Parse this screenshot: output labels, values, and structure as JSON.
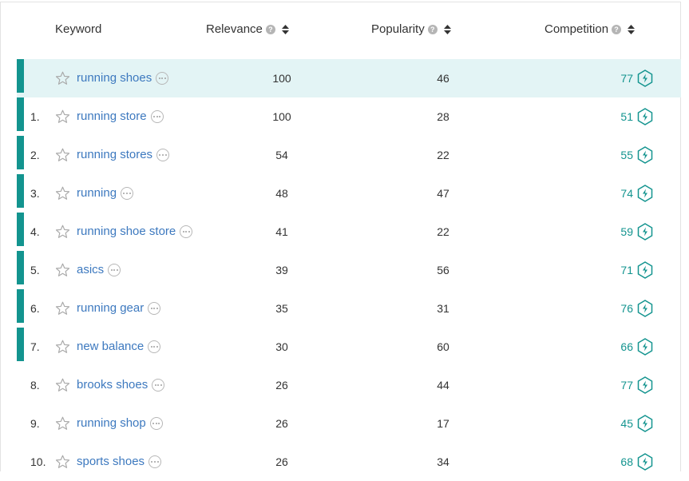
{
  "header": {
    "keyword": "Keyword",
    "relevance": "Relevance",
    "popularity": "Popularity",
    "competition": "Competition",
    "help_glyph": "?"
  },
  "colors": {
    "accent": "#13948f",
    "highlight_row": "#e3f4f5",
    "link": "#3d79bf"
  },
  "rows": [
    {
      "num": "",
      "keyword": "running shoes",
      "relevance": "100",
      "popularity": "46",
      "competition": "77",
      "highlighted": true,
      "bar": true
    },
    {
      "num": "1.",
      "keyword": "running store",
      "relevance": "100",
      "popularity": "28",
      "competition": "51",
      "bar": true
    },
    {
      "num": "2.",
      "keyword": "running stores",
      "relevance": "54",
      "popularity": "22",
      "competition": "55",
      "bar": true
    },
    {
      "num": "3.",
      "keyword": "running",
      "relevance": "48",
      "popularity": "47",
      "competition": "74",
      "bar": true
    },
    {
      "num": "4.",
      "keyword": "running shoe store",
      "relevance": "41",
      "popularity": "22",
      "competition": "59",
      "bar": true
    },
    {
      "num": "5.",
      "keyword": "asics",
      "relevance": "39",
      "popularity": "56",
      "competition": "71",
      "bar": true
    },
    {
      "num": "6.",
      "keyword": "running gear",
      "relevance": "35",
      "popularity": "31",
      "competition": "76",
      "bar": true
    },
    {
      "num": "7.",
      "keyword": "new balance",
      "relevance": "30",
      "popularity": "60",
      "competition": "66",
      "bar": true
    },
    {
      "num": "8.",
      "keyword": "brooks shoes",
      "relevance": "26",
      "popularity": "44",
      "competition": "77",
      "bar": false
    },
    {
      "num": "9.",
      "keyword": "running shop",
      "relevance": "26",
      "popularity": "17",
      "competition": "45",
      "bar": false
    },
    {
      "num": "10.",
      "keyword": "sports shoes",
      "relevance": "26",
      "popularity": "34",
      "competition": "68",
      "bar": false
    }
  ]
}
